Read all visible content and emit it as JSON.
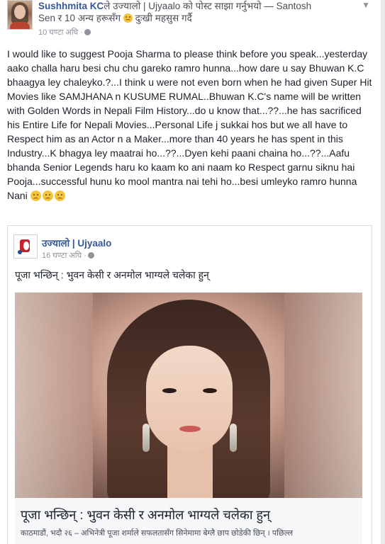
{
  "post": {
    "author": "Sushhmita KC",
    "line1_rest": "ले उज्यालो | Ujyaalo को पोस्ट साझा गर्नुभयो — Santosh",
    "line2": "Sen र 10 अन्य हरूसँग",
    "feeling": "दुःखी महसुस गर्दै",
    "time": "10 घण्टा अघि ·",
    "text": "I would like to suggest Pooja Sharma to please think before you speak...yesterday aako challa haru besi chu chu gareko ramro hunna...how dare u say Bhuwan K.C bhaagya ley chaleyko.?...I think u were not even born when he had given Super Hit Movies like SAMJHANA n KUSUME RUMAL..Bhuwan K.C's name will be written with Golden Words in Nepali Film History...do u know that...??...he has sacrificed his Entire Life for Nepali Movies...Personal Life j sukkai hos but we all have to Respect him as an Actor n a Maker...more than 40 years he has spent in this Industry...K bhagya ley maatrai ho...??...Dyen kehi paani chaina ho...??...Aafu bhanda Senior Legends haru ko kaam ko ani naam ko Respect garnu siknu hai Pooja...successful hunu ko mool mantra nai tehi ho...besi umleyko ramro hunna Nani"
  },
  "shared": {
    "page_name": "उज्यालो | Ujyaalo",
    "time": "16 घण्टा अघि ·",
    "headline": "पूजा भन्छिन् : भुवन केसी र अनमोल भाग्यले चलेका हुन्",
    "caption_title": "पूजा भन्छिन् : भुवन केसी र अनमोल भाग्यले चलेका हुन्",
    "caption_desc": "काठमाडौं, भदौ २६ – अभिनेत्री पूजा शर्माले सफलतासँग सिनेमामा बेग्लै छाप छोडेकी छिन् । पछिल्ल"
  },
  "colors": {
    "link": "#365899",
    "meta": "#90949c"
  }
}
